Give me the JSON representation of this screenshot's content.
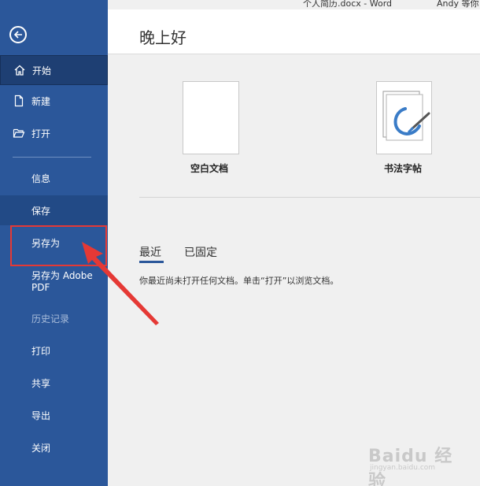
{
  "titlebar": {
    "document_title": "个人简历.docx  -  Word",
    "user": "Andy 等你"
  },
  "sidebar": {
    "back_icon": "back-arrow-icon",
    "items": [
      {
        "label": "开始",
        "icon": "home-icon"
      },
      {
        "label": "新建",
        "icon": "new-document-icon"
      },
      {
        "label": "打开",
        "icon": "open-folder-icon"
      },
      {
        "label": "信息"
      },
      {
        "label": "保存"
      },
      {
        "label": "另存为"
      },
      {
        "label": "另存为 Adobe PDF"
      },
      {
        "label": "历史记录"
      },
      {
        "label": "打印"
      },
      {
        "label": "共享"
      },
      {
        "label": "导出"
      },
      {
        "label": "关闭"
      }
    ],
    "saveas_pdf_line1": "另存为 Adobe",
    "saveas_pdf_line2": "PDF"
  },
  "main": {
    "greeting": "晚上好",
    "templates": [
      {
        "label": "空白文档"
      },
      {
        "label": "书法字帖"
      }
    ],
    "tabs": [
      {
        "label": "最近",
        "selected": true
      },
      {
        "label": "已固定",
        "selected": false
      }
    ],
    "empty_message": "你最近尚未打开任何文档。单击“打开”以浏览文档。"
  },
  "colors": {
    "sidebar": "#2b579a",
    "annotation": "#e53935"
  },
  "watermark": {
    "brand": "Baidu 经验",
    "sub": "jingyan.baidu.com"
  }
}
